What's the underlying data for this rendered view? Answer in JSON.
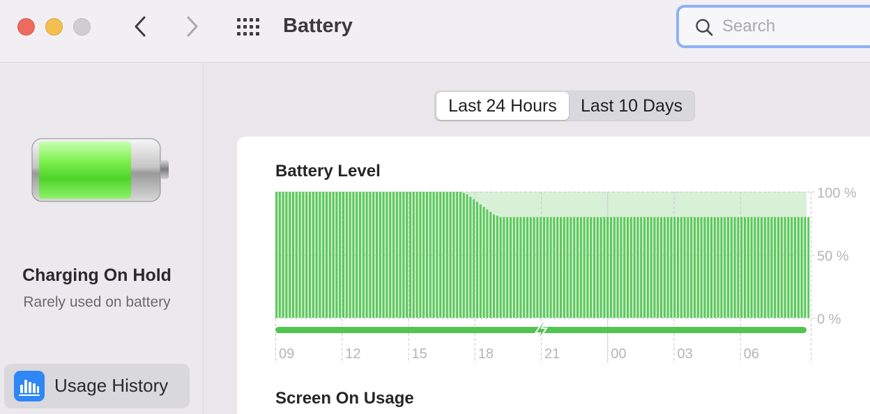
{
  "window": {
    "title": "Battery",
    "search_placeholder": "Search"
  },
  "sidebar": {
    "status_title": "Charging On Hold",
    "status_subtitle": "Rarely used on battery",
    "items": [
      {
        "label": "Usage History",
        "icon": "usage-history-icon",
        "selected": true
      }
    ]
  },
  "range_selector": {
    "options": [
      "Last 24 Hours",
      "Last 10 Days"
    ],
    "selected": "Last 24 Hours"
  },
  "chart_data": {
    "type": "bar",
    "title": "Battery Level",
    "y_tick_labels": [
      "100 %",
      "50 %",
      "0 %"
    ],
    "ylim": [
      0,
      100
    ],
    "x_tick_labels": [
      "09",
      "12",
      "15",
      "18",
      "21",
      "00",
      "03",
      "06"
    ],
    "series": [
      {
        "values": [
          100,
          100,
          100,
          100,
          100,
          100,
          100,
          100,
          100,
          100,
          100,
          100,
          100,
          100,
          100,
          100,
          100,
          100,
          100,
          100,
          100,
          100,
          100,
          100,
          100,
          100,
          100,
          100,
          100,
          100,
          100,
          100,
          100,
          100,
          100,
          100,
          100,
          100,
          100,
          100,
          100,
          100,
          100,
          100,
          100,
          100,
          100,
          100,
          100,
          100,
          100,
          100,
          100,
          100,
          100,
          100,
          99,
          98,
          96,
          94,
          92,
          90,
          88,
          86,
          84,
          82,
          81,
          80,
          80,
          80,
          80,
          80,
          80,
          80,
          80,
          80,
          80,
          80,
          80,
          80,
          80,
          80,
          80,
          80,
          80,
          80,
          80,
          80,
          80,
          80,
          80,
          80,
          80,
          80,
          80,
          80,
          80,
          80,
          80,
          80,
          80,
          80,
          80,
          80,
          80,
          80,
          80,
          80,
          80,
          80,
          80,
          80,
          80,
          80,
          80,
          80,
          80,
          80,
          80,
          80,
          80,
          80,
          80,
          80,
          80,
          80,
          80,
          80,
          80,
          80,
          80,
          80,
          80,
          80,
          80,
          80,
          80,
          80,
          80,
          80,
          80,
          80,
          80,
          80,
          80,
          80,
          80,
          80,
          80,
          80,
          80,
          80,
          80,
          80,
          80,
          80,
          80,
          80,
          80,
          80
        ]
      }
    ],
    "charging_indicator": "charging-bolt-icon",
    "grid": true,
    "colors": {
      "bar": "#5bc85b",
      "background": "#d8f0d6",
      "charging_line": "#52c452"
    }
  },
  "sections": {
    "screen_on_usage": "Screen On Usage"
  }
}
